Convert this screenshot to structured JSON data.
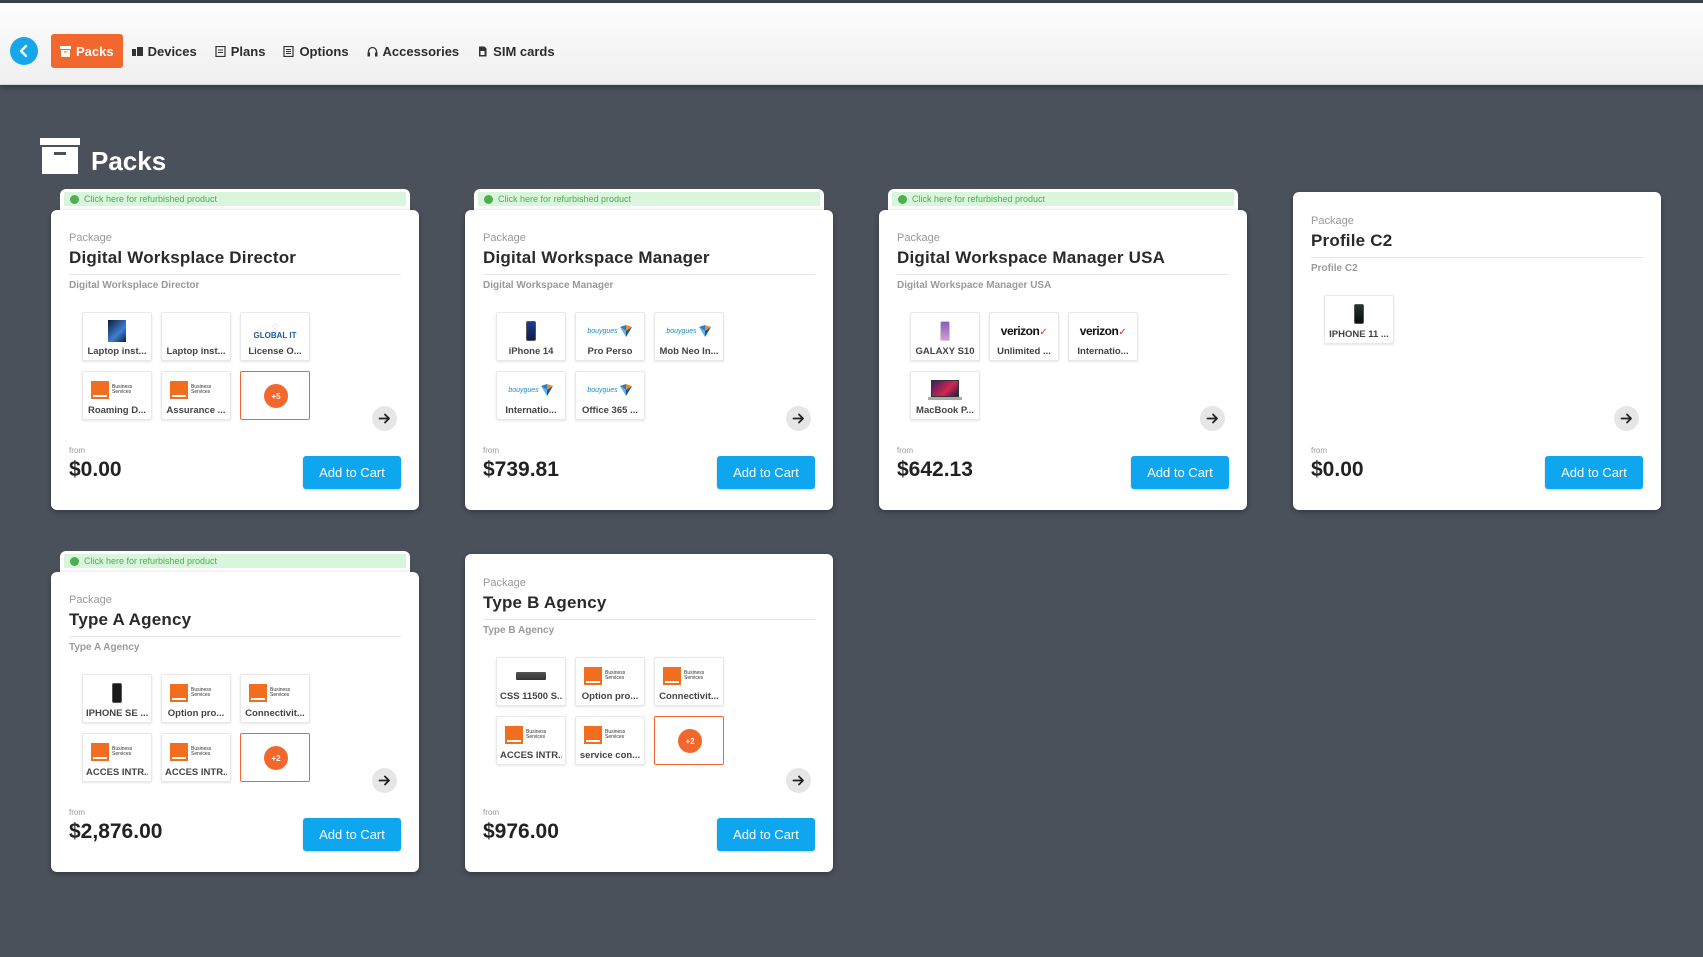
{
  "nav": {
    "items": [
      {
        "label": "Packs",
        "icon": "box-icon",
        "active": true
      },
      {
        "label": "Devices",
        "icon": "devices-icon",
        "active": false
      },
      {
        "label": "Plans",
        "icon": "plans-icon",
        "active": false
      },
      {
        "label": "Options",
        "icon": "options-icon",
        "active": false
      },
      {
        "label": "Accessories",
        "icon": "headphones-icon",
        "active": false
      },
      {
        "label": "SIM cards",
        "icon": "sim-card-icon",
        "active": false
      }
    ]
  },
  "page": {
    "title": "Packs"
  },
  "common": {
    "package_label": "Package",
    "refurb_text": "Click here for refurbished product",
    "from_label": "from",
    "add_to_cart": "Add to Cart"
  },
  "cards": [
    {
      "name": "Digital Worksplace Director",
      "subtitle": "Digital Worksplace Director",
      "price": "$0.00",
      "refurbished": true,
      "items": [
        {
          "label": "Laptop inst...",
          "thumb": "laptop-box"
        },
        {
          "label": "Laptop inst...",
          "thumb": "blank"
        },
        {
          "label": "License O...",
          "thumb": "global-it-logo",
          "thumb_text": "GLOBAL IT"
        },
        {
          "label": "Roaming D...",
          "thumb": "orange-logo"
        },
        {
          "label": "Assurance ...",
          "thumb": "orange-logo"
        }
      ],
      "more": "+5"
    },
    {
      "name": "Digital Workspace Manager",
      "subtitle": "Digital Workspace Manager",
      "price": "$739.81",
      "refurbished": true,
      "items": [
        {
          "label": "iPhone 14",
          "thumb": "phone-blue"
        },
        {
          "label": "Pro Perso",
          "thumb": "bouygues-logo"
        },
        {
          "label": "Mob Neo In...",
          "thumb": "bouygues-logo"
        },
        {
          "label": "Internatio...",
          "thumb": "bouygues-logo"
        },
        {
          "label": "Office 365 ...",
          "thumb": "bouygues-logo"
        }
      ],
      "more": ""
    },
    {
      "name": "Digital Workspace Manager USA",
      "subtitle": "Digital Workspace Manager USA",
      "price": "$642.13",
      "refurbished": true,
      "items": [
        {
          "label": "GALAXY S10",
          "thumb": "phone-purple"
        },
        {
          "label": "Unlimited ...",
          "thumb": "verizon-logo"
        },
        {
          "label": "Internatio...",
          "thumb": "verizon-logo"
        },
        {
          "label": "MacBook P...",
          "thumb": "macbook"
        }
      ],
      "more": ""
    },
    {
      "name": "Profile C2",
      "subtitle": "Profile C2",
      "price": "$0.00",
      "refurbished": false,
      "items": [
        {
          "label": "IPHONE 11 ...",
          "thumb": "phone-dark"
        }
      ],
      "more": ""
    },
    {
      "name": "Type A Agency",
      "subtitle": "Type A Agency",
      "price": "$2,876.00",
      "refurbished": true,
      "items": [
        {
          "label": "IPHONE SE ...",
          "thumb": "phone-black"
        },
        {
          "label": "Option pro...",
          "thumb": "orange-logo"
        },
        {
          "label": "Connectivit...",
          "thumb": "orange-logo"
        },
        {
          "label": "ACCES INTR...",
          "thumb": "orange-logo"
        },
        {
          "label": "ACCES INTR...",
          "thumb": "orange-logo"
        }
      ],
      "more": "+2"
    },
    {
      "name": "Type B Agency",
      "subtitle": "Type B Agency",
      "price": "$976.00",
      "refurbished": false,
      "items": [
        {
          "label": "CSS 11500 S...",
          "thumb": "switch"
        },
        {
          "label": "Option pro...",
          "thumb": "orange-logo"
        },
        {
          "label": "Connectivit...",
          "thumb": "orange-logo"
        },
        {
          "label": "ACCES INTR...",
          "thumb": "orange-logo"
        },
        {
          "label": "service con...",
          "thumb": "orange-logo"
        }
      ],
      "more": "+2"
    }
  ],
  "colors": {
    "accent": "#f2672e",
    "primary_button": "#0ea6ee",
    "background": "#4a515b",
    "refurb_badge": "#d9f5dc"
  }
}
